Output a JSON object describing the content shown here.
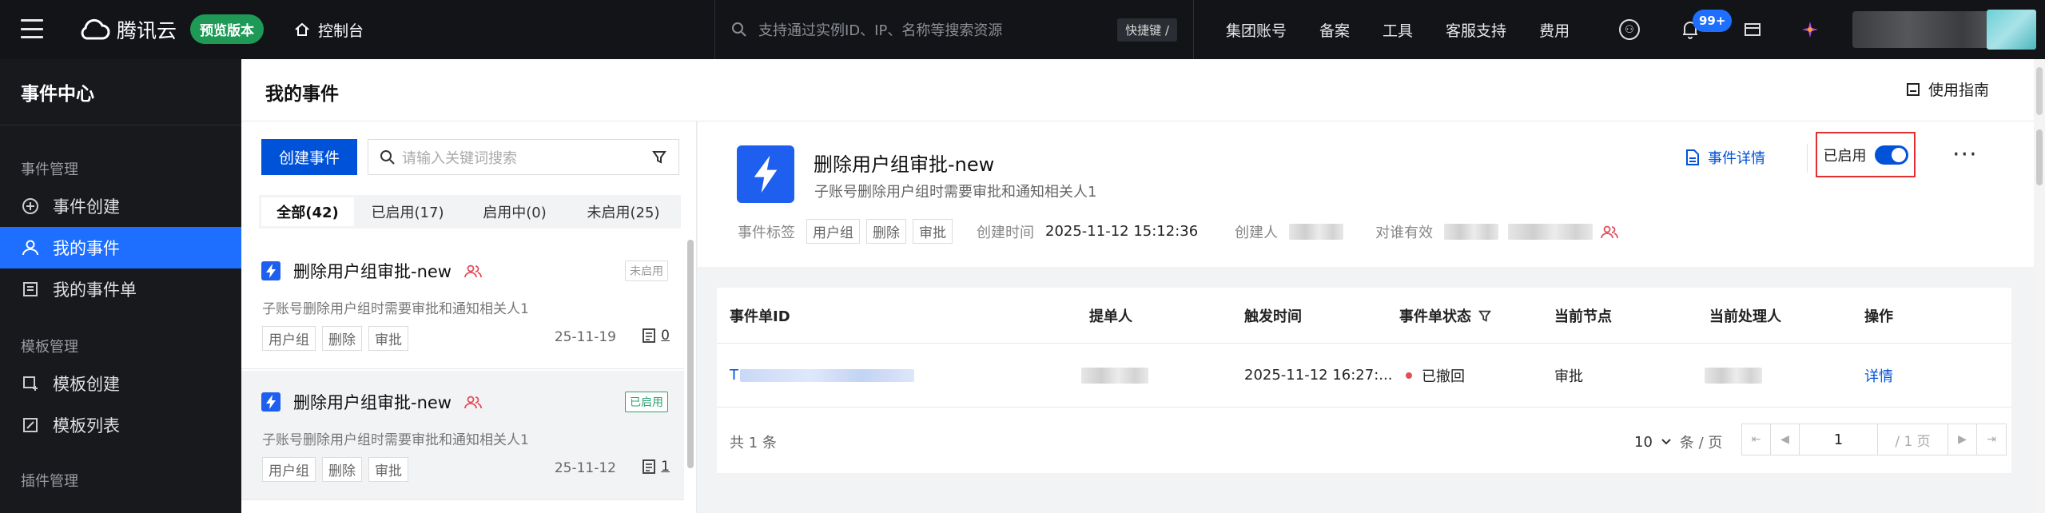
{
  "topbar": {
    "brand": "腾讯云",
    "preview_badge": "预览版本",
    "console": "控制台",
    "search_placeholder": "支持通过实例ID、IP、名称等搜索资源",
    "shortcut": "快捷键 /",
    "nav": [
      "集团账号",
      "备案",
      "工具",
      "客服支持",
      "费用"
    ],
    "notif_count": "99+"
  },
  "sidebar": {
    "title": "事件中心",
    "groups": [
      {
        "label": "事件管理",
        "items": [
          {
            "label": "事件创建",
            "icon": "plus-circle-icon"
          },
          {
            "label": "我的事件",
            "icon": "user-icon",
            "active": true
          },
          {
            "label": "我的事件单",
            "icon": "ticket-icon"
          }
        ]
      },
      {
        "label": "模板管理",
        "items": [
          {
            "label": "模板创建",
            "icon": "template-add-icon"
          },
          {
            "label": "模板列表",
            "icon": "template-list-icon"
          }
        ]
      },
      {
        "label": "插件管理",
        "items": []
      }
    ]
  },
  "main": {
    "title": "我的事件",
    "guide": "使用指南"
  },
  "list": {
    "create_button": "创建事件",
    "search_placeholder": "请输入关键词搜索",
    "tabs": [
      "全部(42)",
      "已启用(17)",
      "启用中(0)",
      "未启用(25)"
    ],
    "cards": [
      {
        "name": "删除用户组审批-new",
        "state": "未启用",
        "desc": "子账号删除用户组时需要审批和通知相关人1",
        "tags": [
          "用户组",
          "删除",
          "审批"
        ],
        "date": "25-11-19",
        "count": "0"
      },
      {
        "name": "删除用户组审批-new",
        "state": "已启用",
        "desc": "子账号删除用户组时需要审批和通知相关人1",
        "tags": [
          "用户组",
          "删除",
          "审批"
        ],
        "date": "25-11-12",
        "count": "1"
      }
    ]
  },
  "detail": {
    "name": "删除用户组审批-new",
    "desc": "子账号删除用户组时需要审批和通知相关人1",
    "tags_label": "事件标签",
    "tags": [
      "用户组",
      "删除",
      "审批"
    ],
    "created_label": "创建时间",
    "created_value": "2025-11-12 15:12:36",
    "creator_label": "创建人",
    "scope_label": "对谁有效",
    "detail_link": "事件详情",
    "enabled_label": "已启用",
    "more": "···"
  },
  "table": {
    "headers": [
      "事件单ID",
      "提单人",
      "触发时间",
      "事件单状态",
      "当前节点",
      "当前处理人",
      "操作"
    ],
    "row": {
      "id_prefix": "T",
      "time": "2025-11-12 16:27:...",
      "status": "已撤回",
      "node": "审批",
      "action": "详情"
    },
    "total": "共 1 条",
    "page_size": "10",
    "per_page": "条 / 页",
    "page": "1",
    "page_total": "/ 1 页"
  },
  "colors": {
    "accent": "#0052d9",
    "topbar": "#121418",
    "sidebar": "#17191d",
    "enabled_border": "#e03030",
    "preview_badge": "#1e9a56"
  }
}
